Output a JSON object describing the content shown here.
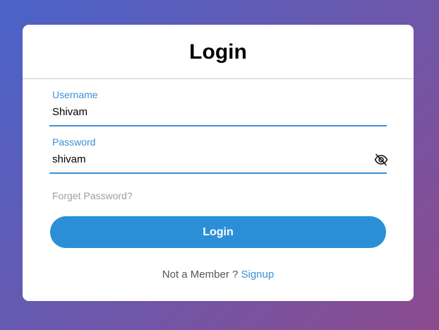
{
  "colors": {
    "accent": "#3d8fd6",
    "button": "#2b8fd8",
    "muted": "#a0a0a0",
    "background_start": "#4a63c9",
    "background_end": "#8c4b8e"
  },
  "login_form": {
    "title": "Login",
    "username": {
      "label": "Username",
      "value": "Shivam"
    },
    "password": {
      "label": "Password",
      "value": "shivam",
      "toggle_icon": "eye-slash-icon"
    },
    "forgot_password": "Forget Password?",
    "submit_label": "Login",
    "signup_prompt": "Not a Member ?",
    "signup_link": "Signup"
  }
}
